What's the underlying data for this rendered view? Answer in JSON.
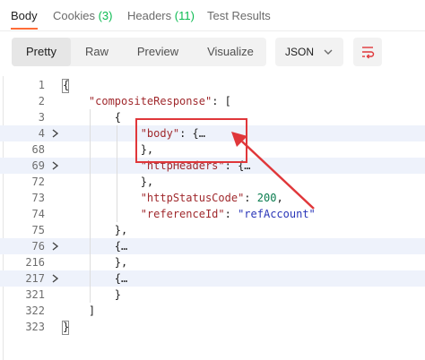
{
  "tabs": [
    {
      "label": "Body",
      "count": ""
    },
    {
      "label": "Cookies ",
      "count": "(3)"
    },
    {
      "label": "Headers ",
      "count": "(11)"
    },
    {
      "label": "Test Results",
      "count": ""
    }
  ],
  "view_modes": [
    "Pretty",
    "Raw",
    "Preview",
    "Visualize"
  ],
  "active_view_mode": "Pretty",
  "format": "JSON",
  "icons": {
    "format_dropdown": "chevron-down-icon",
    "wrap": "wrap-lines-icon",
    "fold_closed": "chevron-right-icon"
  },
  "colors": {
    "accent": "#ff6c37",
    "key": "#a0292d",
    "string": "#2a36b8",
    "number": "#097c4e",
    "callout": "#e0373a"
  },
  "lines": [
    {
      "num": "1",
      "segs": [
        {
          "t": "{",
          "c": "punc"
        }
      ]
    },
    {
      "num": "2",
      "segs": [
        {
          "t": "    ",
          "c": "punc"
        },
        {
          "t": "\"compositeResponse\"",
          "c": "key"
        },
        {
          "t": ": [",
          "c": "punc"
        }
      ]
    },
    {
      "num": "3",
      "segs": [
        {
          "t": "        {",
          "c": "punc"
        }
      ]
    },
    {
      "num": "4",
      "fold": true,
      "hl": true,
      "segs": [
        {
          "t": "            ",
          "c": "punc"
        },
        {
          "t": "\"body\"",
          "c": "key"
        },
        {
          "t": ": {…",
          "c": "punc"
        }
      ]
    },
    {
      "num": "68",
      "segs": [
        {
          "t": "            },",
          "c": "punc"
        }
      ]
    },
    {
      "num": "69",
      "fold": true,
      "hl": true,
      "segs": [
        {
          "t": "            ",
          "c": "punc"
        },
        {
          "t": "\"httpHeaders\"",
          "c": "key"
        },
        {
          "t": ": {…",
          "c": "punc"
        }
      ]
    },
    {
      "num": "72",
      "segs": [
        {
          "t": "            },",
          "c": "punc"
        }
      ]
    },
    {
      "num": "73",
      "segs": [
        {
          "t": "            ",
          "c": "punc"
        },
        {
          "t": "\"httpStatusCode\"",
          "c": "key"
        },
        {
          "t": ": ",
          "c": "punc"
        },
        {
          "t": "200",
          "c": "num"
        },
        {
          "t": ",",
          "c": "punc"
        }
      ]
    },
    {
      "num": "74",
      "segs": [
        {
          "t": "            ",
          "c": "punc"
        },
        {
          "t": "\"referenceId\"",
          "c": "key"
        },
        {
          "t": ": ",
          "c": "punc"
        },
        {
          "t": "\"refAccount\"",
          "c": "str"
        }
      ]
    },
    {
      "num": "75",
      "segs": [
        {
          "t": "        },",
          "c": "punc"
        }
      ]
    },
    {
      "num": "76",
      "fold": true,
      "hl": true,
      "segs": [
        {
          "t": "        {…",
          "c": "punc"
        }
      ]
    },
    {
      "num": "216",
      "segs": [
        {
          "t": "        },",
          "c": "punc"
        }
      ]
    },
    {
      "num": "217",
      "fold": true,
      "hl": true,
      "segs": [
        {
          "t": "        {…",
          "c": "punc"
        }
      ]
    },
    {
      "num": "321",
      "segs": [
        {
          "t": "        }",
          "c": "punc"
        }
      ]
    },
    {
      "num": "322",
      "segs": [
        {
          "t": "    ]",
          "c": "punc"
        }
      ]
    },
    {
      "num": "323",
      "segs": [
        {
          "t": "}",
          "c": "punc"
        }
      ]
    }
  ]
}
